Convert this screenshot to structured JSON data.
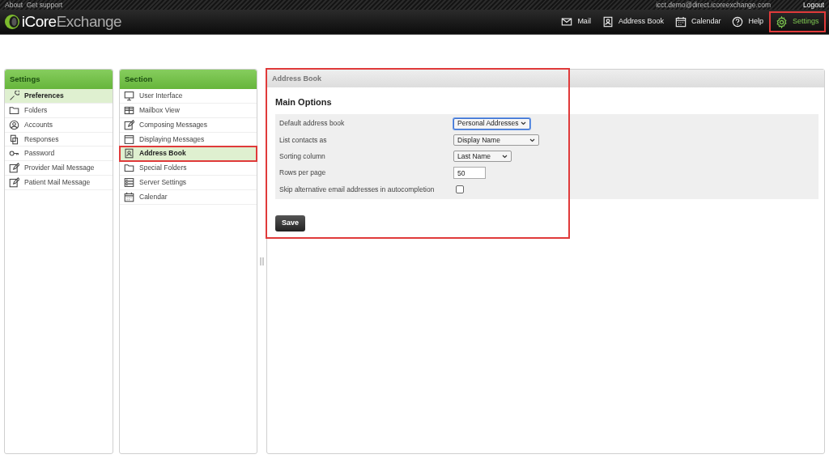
{
  "top_links": [
    "About",
    "Get support"
  ],
  "user_email": "icct.demo@direct.icoreexchange.com",
  "logout": "Logout",
  "logo": {
    "bold": "iCore",
    "light": "Exchange"
  },
  "nav": [
    {
      "label": "Mail",
      "selected": false,
      "annotated": false
    },
    {
      "label": "Address Book",
      "selected": false,
      "annotated": false
    },
    {
      "label": "Calendar",
      "selected": false,
      "annotated": false
    },
    {
      "label": "Help",
      "selected": false,
      "annotated": false
    },
    {
      "label": "Settings",
      "selected": true,
      "annotated": true
    }
  ],
  "settings_panel": {
    "title": "Settings",
    "items": [
      {
        "label": "Preferences",
        "selected": true
      },
      {
        "label": "Folders",
        "selected": false
      },
      {
        "label": "Accounts",
        "selected": false
      },
      {
        "label": "Responses",
        "selected": false
      },
      {
        "label": "Password",
        "selected": false
      },
      {
        "label": "Provider Mail Message",
        "selected": false
      },
      {
        "label": "Patient Mail Message",
        "selected": false
      }
    ]
  },
  "section_panel": {
    "title": "Section",
    "items": [
      {
        "label": "User Interface",
        "selected": false,
        "annotated": false
      },
      {
        "label": "Mailbox View",
        "selected": false,
        "annotated": false
      },
      {
        "label": "Composing Messages",
        "selected": false,
        "annotated": false
      },
      {
        "label": "Displaying Messages",
        "selected": false,
        "annotated": false
      },
      {
        "label": "Address Book",
        "selected": true,
        "annotated": true
      },
      {
        "label": "Special Folders",
        "selected": false,
        "annotated": false
      },
      {
        "label": "Server Settings",
        "selected": false,
        "annotated": false
      },
      {
        "label": "Calendar",
        "selected": false,
        "annotated": false
      }
    ]
  },
  "content": {
    "title": "Address Book",
    "annotated": true,
    "heading": "Main Options",
    "rows": [
      {
        "kind": "select",
        "label": "Default address book",
        "value": "Personal Addresses",
        "focused": true
      },
      {
        "kind": "select",
        "label": "List contacts as",
        "value": "Display Name",
        "focused": false
      },
      {
        "kind": "select",
        "label": "Sorting column",
        "value": "Last Name",
        "focused": false
      },
      {
        "kind": "text",
        "label": "Rows per page",
        "value": "50"
      },
      {
        "kind": "checkbox",
        "label": "Skip alternative email addresses in autocompletion",
        "checked": false
      }
    ],
    "save": "Save"
  }
}
